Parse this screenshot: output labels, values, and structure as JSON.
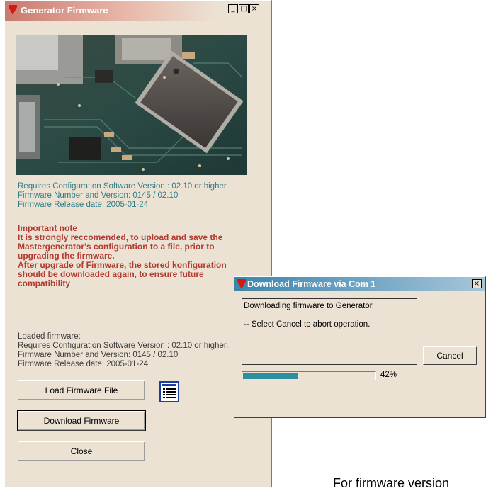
{
  "main_window": {
    "title": "Generator Firmware",
    "controls": {
      "minimize": "_",
      "maximize": "□",
      "close": "×"
    },
    "firmware_info": [
      "Requires Configuration Software Version : 02.10 or higher.",
      "Firmware Number and Version: 0145 / 02.10",
      "Firmware Release date: 2005-01-24"
    ],
    "important_note": [
      "Important note",
      "It is strongly reccomended, to upload and save the",
      "Mastergenerator's configuration to a file, prior to",
      "upgrading the firmware.",
      "After upgrade of Firmware, the stored konfiguration",
      "should be downloaded again, to ensure future",
      "compatibility"
    ],
    "loaded_firmware": [
      "Loaded firmware:",
      "Requires Configuration Software Version : 02.10 or higher.",
      "Firmware Number and Version: 0145 / 02.10",
      "Firmware Release date: 2005-01-24"
    ],
    "buttons": {
      "load": "Load Firmware File",
      "download": "Download Firmware",
      "close": "Close"
    },
    "list_icon": "list-view-icon",
    "colors": {
      "info_text": "#2d7e86",
      "note_text": "#b23a2e",
      "logo": "#d11a10"
    }
  },
  "dialog": {
    "title": "Download Firmware via Com 1",
    "close_glyph": "×",
    "message_lines": [
      "Downloading firmware to Generator.",
      "",
      "-- Select Cancel to abort operation."
    ],
    "cancel_label": "Cancel",
    "progress_percent": 42,
    "progress_label": "42%",
    "progress_color": "#2e8ea0"
  },
  "footer_text": "For firmware version"
}
